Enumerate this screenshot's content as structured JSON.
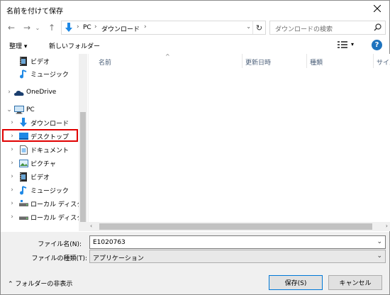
{
  "window": {
    "title": "名前を付けて保存"
  },
  "address": {
    "segments": [
      "PC",
      "ダウンロード"
    ]
  },
  "search": {
    "placeholder": "ダウンロードの検索"
  },
  "toolbar": {
    "organize_label": "整理",
    "new_folder_label": "新しいフォルダー"
  },
  "tree": [
    {
      "label": "ビデオ",
      "icon": "video-icon",
      "chev": ""
    },
    {
      "label": "ミュージック",
      "icon": "music-icon",
      "chev": ""
    },
    {
      "label": "OneDrive",
      "icon": "onedrive-icon",
      "chev": "›"
    },
    {
      "label": "PC",
      "icon": "pc-icon",
      "chev": "⌄"
    },
    {
      "label": "ダウンロード",
      "icon": "download-icon",
      "chev": "›"
    },
    {
      "label": "デスクトップ",
      "icon": "desktop-icon",
      "chev": "›"
    },
    {
      "label": "ドキュメント",
      "icon": "document-icon",
      "chev": "›"
    },
    {
      "label": "ピクチャ",
      "icon": "picture-icon",
      "chev": "›"
    },
    {
      "label": "ビデオ",
      "icon": "video-icon",
      "chev": "›"
    },
    {
      "label": "ミュージック",
      "icon": "music-icon",
      "chev": "›"
    },
    {
      "label": "ローカル ディスク (C",
      "icon": "drive-icon",
      "chev": "›"
    },
    {
      "label": "ローカル ディスク (D",
      "icon": "drive-icon",
      "chev": "›"
    }
  ],
  "columns": {
    "name": "名前",
    "modified": "更新日時",
    "type": "種類",
    "size": "サイズ"
  },
  "form": {
    "filename_label": "ファイル名(N):",
    "filename_value": "E1020763",
    "filetype_label": "ファイルの種類(T):",
    "filetype_value": "アプリケーション"
  },
  "footer": {
    "hide_folders_label": "フォルダーの非表示",
    "save_label": "保存(S)",
    "cancel_label": "キャンセル"
  },
  "colors": {
    "selection_border": "#e00000",
    "accent": "#0078d7",
    "help": "#1e73be"
  }
}
